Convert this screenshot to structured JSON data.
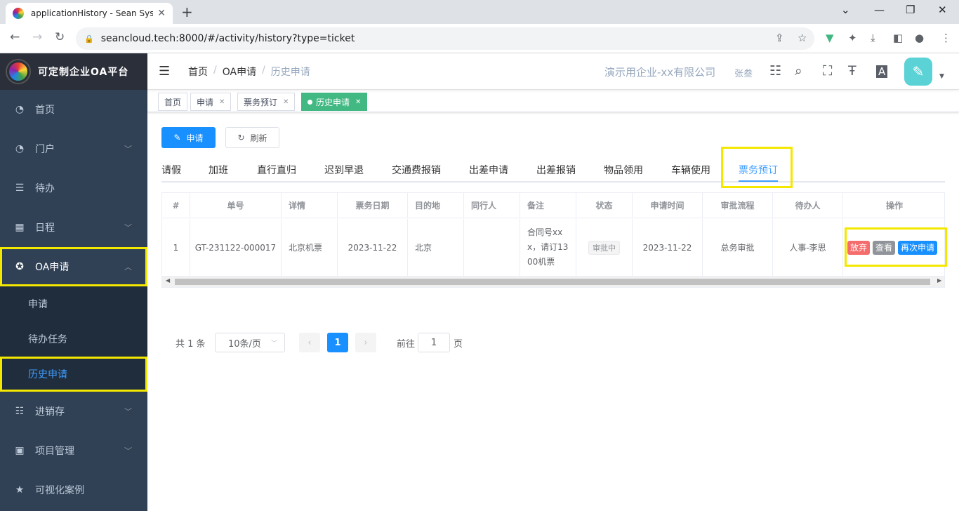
{
  "browser": {
    "tab_title": "applicationHistory - Sean Syst",
    "url": "seancloud.tech:8000/#/activity/history?type=ticket"
  },
  "sidebar": {
    "logo_text": "可定制企业OA平台",
    "items": [
      {
        "label": "首页",
        "icon": "dashboard-icon"
      },
      {
        "label": "门户",
        "icon": "dashboard-icon"
      },
      {
        "label": "待办",
        "icon": "list-icon"
      },
      {
        "label": "日程",
        "icon": "grid-icon"
      },
      {
        "label": "OA申请",
        "icon": "settings-icon"
      },
      {
        "label": "申请"
      },
      {
        "label": "待办任务"
      },
      {
        "label": "历史申请"
      },
      {
        "label": "进销存",
        "icon": "table-icon"
      },
      {
        "label": "项目管理",
        "icon": "grid-icon"
      },
      {
        "label": "可视化案例",
        "icon": "star-icon"
      }
    ]
  },
  "header": {
    "breadcrumb": [
      "首页",
      "OA申请",
      "历史申请"
    ],
    "company": "演示用企业-xx有限公司",
    "user": "张叁"
  },
  "tags": [
    {
      "label": "首页"
    },
    {
      "label": "申请"
    },
    {
      "label": "票务预订"
    },
    {
      "label": "历史申请"
    }
  ],
  "toolbar": {
    "apply": "申请",
    "refresh": "刷新"
  },
  "tabs": [
    "请假",
    "加班",
    "直行直归",
    "迟到早退",
    "交通费报销",
    "出差申请",
    "出差报销",
    "物品领用",
    "车辆使用",
    "票务预订"
  ],
  "table": {
    "columns": [
      "#",
      "单号",
      "详情",
      "票务日期",
      "目的地",
      "同行人",
      "备注",
      "状态",
      "申请时间",
      "审批流程",
      "待办人",
      "操作"
    ],
    "row": {
      "index": "1",
      "number": "GT-231122-000017",
      "detail": "北京机票",
      "ticket_date": "2023-11-22",
      "destination": "北京",
      "companion": "",
      "note": "合同号xxx，请订1300机票",
      "status": "审批中",
      "apply_time": "2023-11-22",
      "flow": "总务审批",
      "assignee": "人事-李思",
      "ops": [
        "放弃",
        "查看",
        "再次申请"
      ]
    }
  },
  "pagination": {
    "total": "共 1 条",
    "page_size": "10条/页",
    "current": "1",
    "goto_prefix": "前往",
    "goto_value": "1",
    "goto_suffix": "页"
  },
  "colors": {
    "primary": "#1890ff",
    "highlight": "#f5e800",
    "sidebar": "#304156",
    "danger": "#f56c6c",
    "info": "#909399"
  }
}
